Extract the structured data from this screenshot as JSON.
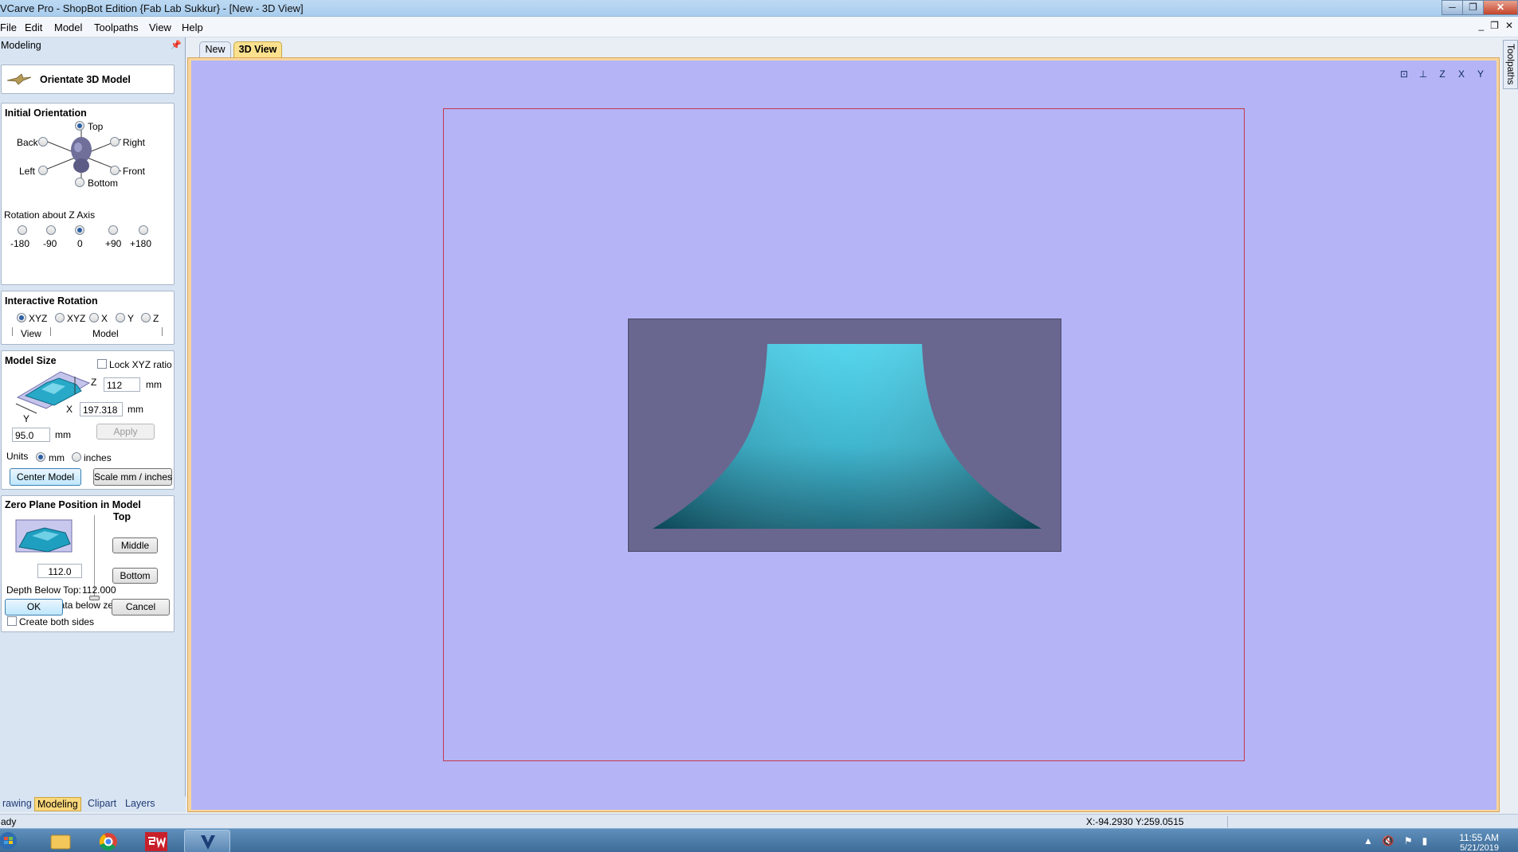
{
  "window": {
    "title": "VCarve Pro - ShopBot Edition {Fab Lab Sukkur} - [New - 3D View]",
    "controls": [
      "─",
      "❐",
      "✕"
    ]
  },
  "menu": {
    "items": [
      "File",
      "Edit",
      "Model",
      "Toolpaths",
      "View",
      "Help"
    ],
    "mdi_controls": [
      "_",
      "❐",
      "✕"
    ]
  },
  "panel": {
    "title": "Modeling",
    "pin_icon": "pin-icon",
    "header": {
      "title": "Orientate 3D Model",
      "icon": "bird-icon"
    },
    "initial_orientation": {
      "title": "Initial Orientation",
      "options": {
        "top": "Top",
        "back": "Back",
        "right": "Right",
        "left": "Left",
        "front": "Front",
        "bottom": "Bottom"
      },
      "selected": "Top",
      "rotation_label": "Rotation about Z Axis",
      "rotation_options": [
        "-180",
        "-90",
        "0",
        "+90",
        "+180"
      ],
      "rotation_selected": "0"
    },
    "interactive_rotation": {
      "title": "Interactive Rotation",
      "options": [
        "XYZ",
        "XYZ",
        "X",
        "Y",
        "Z"
      ],
      "selected": "XYZ",
      "group_view": "View",
      "group_model": "Model"
    },
    "model_size": {
      "title": "Model Size",
      "lock_label": "Lock XYZ ratio",
      "lock_checked": false,
      "z_label": "Z",
      "z_value": "112",
      "x_label": "X",
      "x_value": "197.318",
      "y_label": "Y",
      "y_value": "95.0",
      "unit": "mm",
      "apply_label": "Apply",
      "units_label": "Units",
      "unit_mm": "mm",
      "unit_inches": "inches",
      "units_selected": "mm",
      "center_model_label": "Center Model",
      "scale_label": "Scale mm / inches"
    },
    "zero_plane": {
      "title": "Zero Plane Position in Model",
      "top_label": "Top",
      "middle_label": "Middle",
      "bottom_label": "Bottom",
      "value": "112.0",
      "depth_label": "Depth Below Top:",
      "depth_value": "112.000",
      "discard_label": "Discard data below zero plane",
      "discard_checked": true,
      "both_sides_label": "Create both sides",
      "both_sides_checked": false
    },
    "ok_label": "OK",
    "cancel_label": "Cancel"
  },
  "bottom_tabs": {
    "items": [
      "rawing",
      "Modeling",
      "Clipart",
      "Layers"
    ],
    "active": "Modeling"
  },
  "doc_tabs": {
    "items": [
      "New",
      "3D View"
    ],
    "active": "3D View"
  },
  "view_toolbar": {
    "icons": [
      "zoom-extents-icon",
      "iso-view-icon",
      "z-axis-view-icon",
      "x-axis-view-icon",
      "y-axis-view-icon"
    ],
    "glyphs": [
      "⊡",
      "⊥",
      "Z",
      "X",
      "Y"
    ]
  },
  "right_tab": {
    "label": "Toolpaths"
  },
  "viewport": {
    "background": "#b4b4f6",
    "model_color": "#2fb9d4",
    "box_color": "#69678f",
    "border_color": "#c23a4e"
  },
  "status": {
    "ready": "ady",
    "coords": "X:-94.2930 Y:259.0515"
  },
  "taskbar": {
    "time": "11:55 AM",
    "date": "5/21/2019"
  }
}
